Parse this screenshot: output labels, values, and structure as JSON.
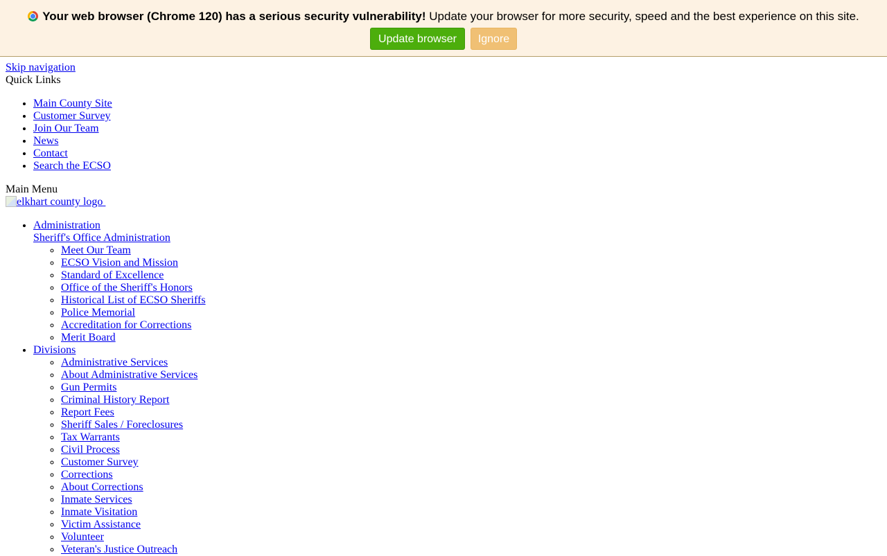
{
  "banner": {
    "bold_text": "Your web browser (Chrome 120) has a serious security vulnerability!",
    "text": " Update your browser for more security, speed and the best experience on this site.",
    "update_label": "Update browser",
    "ignore_label": "Ignore",
    "colors": {
      "background": "#fdf2e3",
      "update": "#4cae0c",
      "ignore": "#f0c074"
    }
  },
  "skip_nav": "Skip navigation",
  "quick_links": {
    "heading": "Quick Links",
    "items": [
      "Main County Site",
      "Customer Survey",
      "Join Our Team",
      "News",
      "Contact",
      "Search the ECSO"
    ]
  },
  "main_menu": {
    "heading": "Main Menu",
    "logo_alt": "elkhart county logo"
  },
  "administration": {
    "label": "Administration",
    "section": "Sheriff's Office Administration",
    "items": [
      "Meet Our Team",
      "ECSO Vision and Mission",
      "Standard of Excellence",
      "Office of the Sheriff's Honors",
      "Historical List of ECSO Sheriffs",
      "Police Memorial",
      "Accreditation for Corrections",
      "Merit Board"
    ]
  },
  "divisions": {
    "label": "Divisions",
    "items": [
      "Administrative Services",
      "About Administrative Services",
      "Gun Permits",
      "Criminal History Report",
      "Report Fees",
      "Sheriff Sales / Foreclosures",
      "Tax Warrants",
      "Civil Process",
      "Customer Survey",
      "Corrections",
      "About Corrections",
      "Inmate Services",
      "Inmate Visitation",
      "Victim Assistance",
      "Volunteer",
      "Veteran's Justice Outreach"
    ]
  }
}
